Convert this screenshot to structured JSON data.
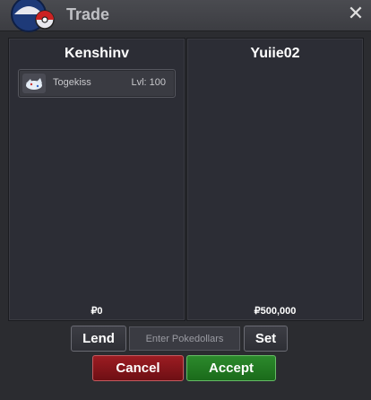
{
  "window": {
    "title": "Trade",
    "close_glyph": "✕"
  },
  "left_panel": {
    "player_name": "Kenshinv",
    "items": [
      {
        "icon": "togekiss-sprite-icon",
        "name": "Togekiss",
        "level": "Lvl: 100"
      }
    ],
    "money": "₽0"
  },
  "right_panel": {
    "player_name": "Yuiie02",
    "items": [],
    "money": "₽500,000"
  },
  "controls": {
    "lend_label": "Lend",
    "pokedollars_placeholder": "Enter Pokedollars",
    "set_label": "Set",
    "cancel_label": "Cancel",
    "accept_label": "Accept"
  },
  "colors": {
    "cancel": "#8a161c",
    "accept": "#218021",
    "background": "#2b2c30"
  }
}
